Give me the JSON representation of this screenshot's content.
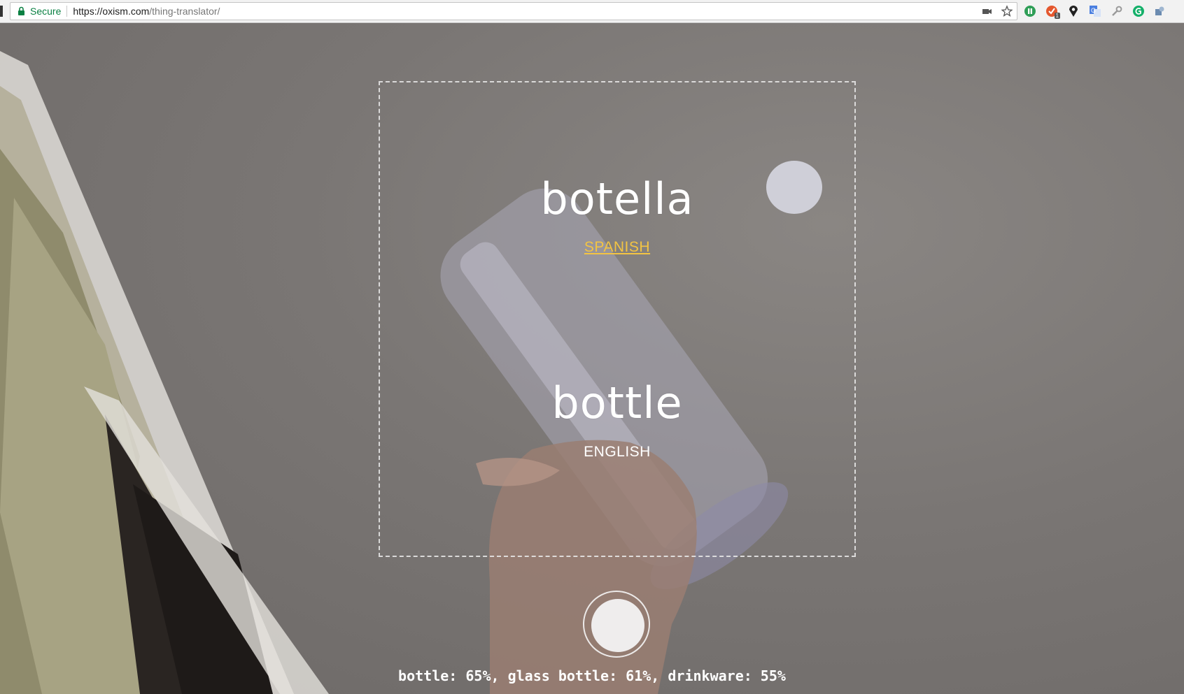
{
  "browser": {
    "secure_label": "Secure",
    "url_host": "https://oxism.com",
    "url_path": "/thing-translator/",
    "icons": [
      "lock-icon",
      "camera-icon",
      "star-icon"
    ],
    "extensions": [
      {
        "name": "extension-green-icon",
        "color": "#2f9e57"
      },
      {
        "name": "extension-orange-icon",
        "color": "#e4572e",
        "badge": "1"
      },
      {
        "name": "extension-pin-icon",
        "color": "#222222"
      },
      {
        "name": "translate-icon",
        "color": "#4a7fe0"
      },
      {
        "name": "wrench-icon",
        "color": "#8a8a8a"
      },
      {
        "name": "grammarly-icon",
        "color": "#15b06a"
      },
      {
        "name": "puzzle-icon",
        "color": "#6b8bb0"
      }
    ]
  },
  "translation": {
    "foreign_word": "botella",
    "foreign_language": "SPANISH",
    "native_word": "bottle",
    "native_language": "ENGLISH"
  },
  "predictions_text": "bottle: 65%, glass bottle: 61%, drinkware: 55%",
  "colors": {
    "language_link": "#f3c443",
    "secure_green": "#0b8043"
  }
}
